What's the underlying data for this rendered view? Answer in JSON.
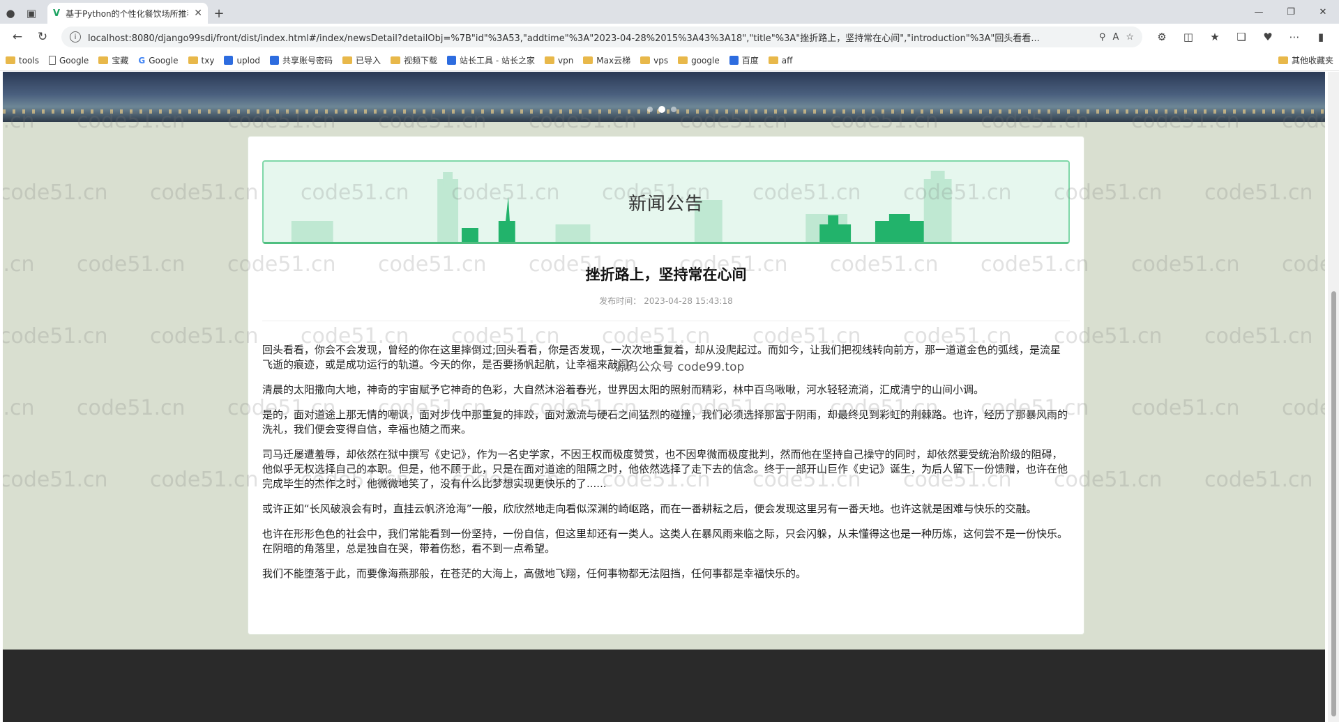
{
  "browser": {
    "tab_title": "基于Python的个性化餐饮场所推荐",
    "url": "localhost:8080/django99sdi/front/dist/index.html#/index/newsDetail?detailObj=%7B\"id\"%3A53,\"addtime\"%3A\"2023-04-28%2015%3A43%3A18\",\"title\"%3A\"挫折路上，坚持常在心间\",\"introduction\"%3A\"回头看看...",
    "bookmarks": [
      "tools",
      "Google",
      "宝藏",
      "Google",
      "txy",
      "uplod",
      "共享账号密码",
      "已导入",
      "视频下载",
      "站长工具 - 站长之家",
      "vpn",
      "Max云梯",
      "vps",
      "google",
      "百度",
      "aff"
    ],
    "other_bookmarks": "其他收藏夹"
  },
  "watermark": "code51.cn",
  "hero": {
    "title": "新闻公告"
  },
  "article": {
    "title": "挫折路上，坚持常在心间",
    "date_label": "发布时间：",
    "date": "2023-04-28 15:43:18",
    "paragraphs": [
      "回头看看，你会不会发现，曾经的你在这里摔倒过;回头看看，你是否发现，一次次地重复着，却从没爬起过。而如今，让我们把视线转向前方，那一道道金色的弧线，是流星飞逝的痕迹，或是成功运行的轨道。今天的你，是否要扬帆起航，让幸福来敲门?",
      "清晨的太阳撒向大地，神奇的宇宙赋予它神奇的色彩，大自然沐浴着春光，世界因太阳的照射而精彩，林中百鸟啾啾，河水轻轻流淌，汇成清宁的山间小调。",
      "是的，面对道途上那无情的嘲讽，面对步伐中那重复的摔跤，面对激流与硬石之间猛烈的碰撞，我们必须选择那富于阴雨，却最终见到彩虹的荆棘路。也许，经历了那暴风雨的洗礼，我们便会变得自信，幸福也随之而来。",
      "司马迁屡遭羞辱，却依然在狱中撰写《史记》，作为一名史学家，不因王权而极度赞赏，也不因卑微而极度批判，然而他在坚持自己操守的同时，却依然要受统治阶级的阻碍，他似乎无权选择自己的本职。但是，他不顾于此，只是在面对道途的阻隔之时，他依然选择了走下去的信念。终于一部开山巨作《史记》诞生，为后人留下一份馈赠，也许在他完成毕生的杰作之时，他微微地笑了，没有什么比梦想实现更快乐的了......",
      "或许正如“长风破浪会有时，直挂云帆济沧海”一般，欣欣然地走向看似深渊的崎岖路，而在一番耕耘之后，便会发现这里另有一番天地。也许这就是困难与快乐的交融。",
      "也许在形形色色的社会中，我们常能看到一份坚持，一份自信，但这里却还有一类人。这类人在暴风雨来临之际，只会闪躲，从未懂得这也是一种历炼，这何尝不是一份快乐。在阴暗的角落里，总是独自在哭，带着伤愁，看不到一点希望。",
      "我们不能堕落于此，而要像海燕那般，在苍茫的大海上，高傲地飞翔，任何事物都无法阻挡，任何事都是幸福快乐的。"
    ]
  },
  "overlay": "源码公众号  code99.top"
}
